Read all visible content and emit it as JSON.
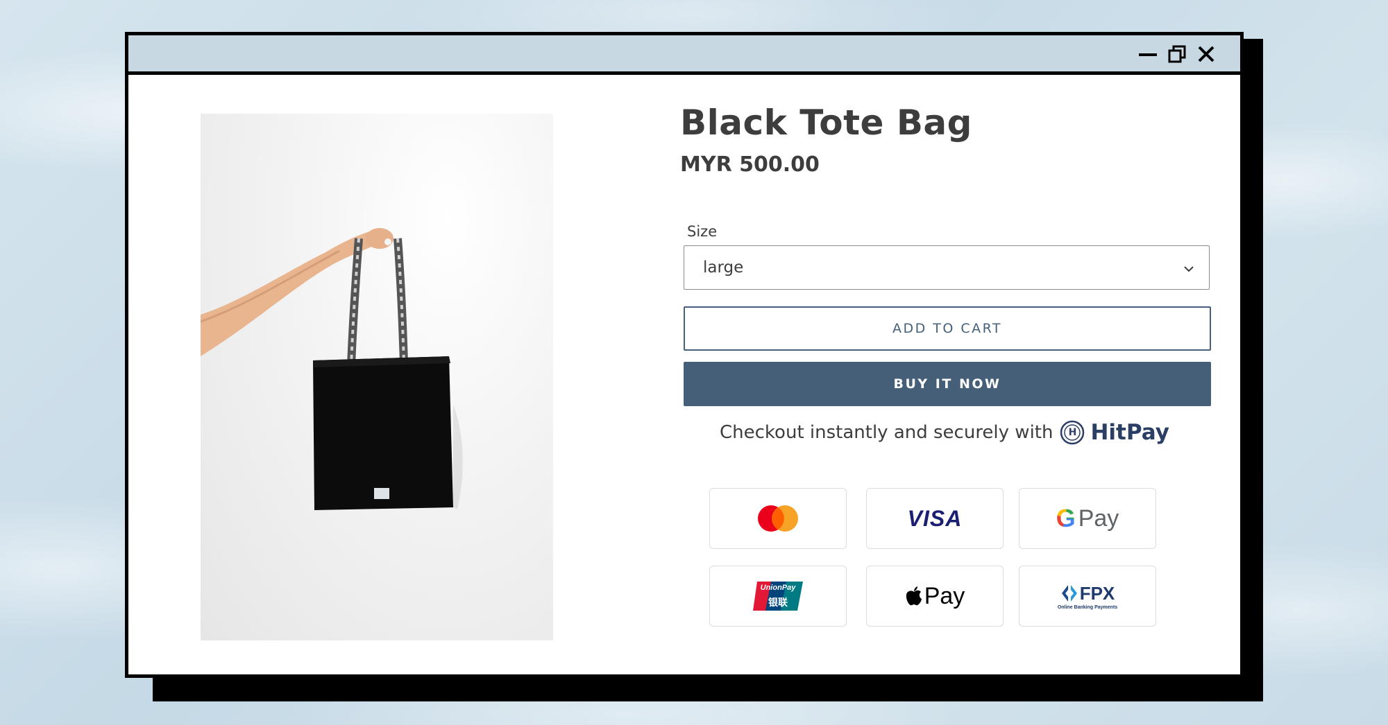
{
  "window": {
    "controls": [
      "minimize-icon",
      "restore-icon",
      "close-icon"
    ]
  },
  "product": {
    "title": "Black Tote Bag",
    "price": "MYR 500.00",
    "image_alt": "Hand holding a black tote bag"
  },
  "options": {
    "size_label": "Size",
    "size_value": "large"
  },
  "buttons": {
    "add_to_cart": "ADD TO CART",
    "buy_now": "BUY IT NOW"
  },
  "checkout": {
    "text": "Checkout instantly and securely with",
    "brand": "HitPay",
    "brand_initial": "H"
  },
  "payment_methods": {
    "visa": "VISA",
    "gpay": "Pay",
    "gpay_g": "G",
    "unionpay_top": "UnionPay",
    "unionpay_bottom": "银联",
    "applepay": "Pay",
    "fpx": "FPX",
    "fpx_sub": "Online Banking Payments"
  },
  "colors": {
    "accent": "#455f78",
    "titlebar": "#c7d8e2",
    "text": "#3d3d3d",
    "hitpay": "#2b3f64"
  }
}
